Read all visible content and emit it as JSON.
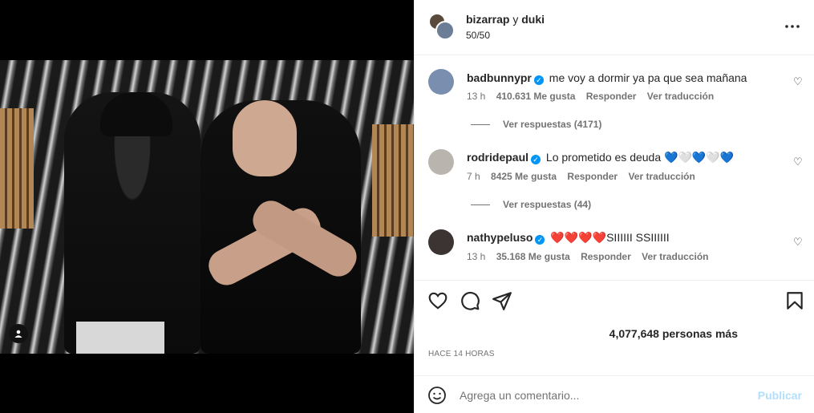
{
  "header": {
    "user1": "bizarrap",
    "conj": "y",
    "user2": "duki",
    "counter": "50/50",
    "more_icon": "more-horizontal-icon"
  },
  "comments": [
    {
      "user": "badbunnypr",
      "verified": true,
      "text": "me voy a dormir ya pa que sea mañana",
      "time": "13 h",
      "likes": "410.631 Me gusta",
      "reply": "Responder",
      "translate": "Ver traducción",
      "replies": "Ver respuestas (4171)",
      "avatar_color": "#7a8fb0"
    },
    {
      "user": "rodridepaul",
      "verified": true,
      "text": "Lo prometido es deuda 💙🤍💙🤍💙",
      "time": "7 h",
      "likes": "8425 Me gusta",
      "reply": "Responder",
      "translate": "Ver traducción",
      "replies": "Ver respuestas (44)",
      "avatar_color": "#b9b4ae"
    },
    {
      "user": "nathypeluso",
      "verified": true,
      "text": "❤️❤️❤️❤️SIIIIII SSIIIIII",
      "time": "13 h",
      "likes": "35.168 Me gusta",
      "reply": "Responder",
      "translate": "Ver traducción",
      "avatar_color": "#3b3432"
    }
  ],
  "actions": {
    "like_icon": "heart-icon",
    "comment_icon": "comment-icon",
    "share_icon": "send-icon",
    "save_icon": "bookmark-icon"
  },
  "likes_text": "4,077,648 personas más",
  "time_ago": "HACE 14 HORAS",
  "comment_box": {
    "placeholder": "Agrega un comentario...",
    "publish": "Publicar",
    "emoji_icon": "emoji-icon"
  },
  "colors": {
    "verified": "#0095f6",
    "publish_disabled": "#b2dffc",
    "meta": "#737373"
  }
}
